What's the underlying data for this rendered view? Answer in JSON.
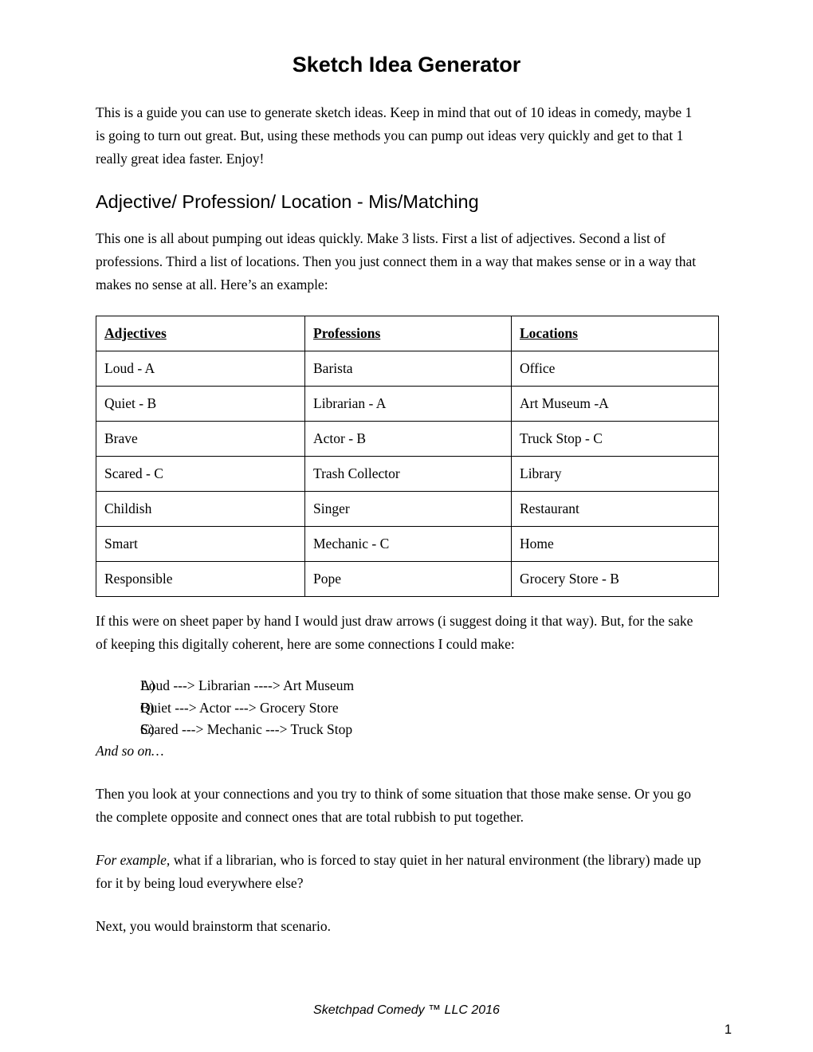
{
  "document": {
    "title": "Sketch Idea Generator",
    "intro_paragraph": "This is a guide you can use to generate sketch ideas. Keep in mind that out of 10 ideas in comedy, maybe 1 is going to turn out great. But, using these methods you can pump out ideas very quickly and get to that 1 really great idea faster. Enjoy!",
    "section_heading": "Adjective/ Profession/ Location - Mis/Matching",
    "section_paragraph": "This one is all about pumping out ideas quickly. Make 3 lists. First a list of adjectives. Second a list of professions. Third a list of locations. Then you just connect them in a way that makes sense or in a way that makes no sense at all. Here’s an example:",
    "post_table_paragraph": "If this were on sheet paper by hand I would just draw arrows (i suggest doing it that way). But, for the sake of keeping this digitally coherent, here are some connections I could make:",
    "and_so_on": "And so on…",
    "then_paragraph": "Then you look at your connections and you try to think of some situation that those make sense. Or you go the complete opposite and connect ones that are total rubbish to put together.",
    "example_label": "For example,",
    "example_paragraph": " what if a librarian, who is forced to stay quiet in her natural environment (the library) made up for it by being loud everywhere else?",
    "next_paragraph": "Next, you would brainstorm that scenario."
  },
  "table": {
    "headers": [
      "Adjectives",
      "Professions",
      "Locations"
    ],
    "rows": [
      [
        "Loud - A",
        "Barista",
        "Office"
      ],
      [
        "Quiet - B",
        "Librarian - A",
        "Art Museum -A"
      ],
      [
        "Brave",
        "Actor - B",
        "Truck Stop - C"
      ],
      [
        "Scared - C",
        "Trash Collector",
        "Library"
      ],
      [
        "Childish",
        "Singer",
        "Restaurant"
      ],
      [
        "Smart",
        "Mechanic - C",
        "Home"
      ],
      [
        "Responsible",
        "Pope",
        "Grocery Store - B"
      ]
    ]
  },
  "connections": [
    {
      "marker": "A)",
      "text": "Loud ---> Librarian ----> Art Museum"
    },
    {
      "marker": "B)",
      "text": "Quiet ---> Actor ---> Grocery Store"
    },
    {
      "marker": "C)",
      "text": "Scared ---> Mechanic ---> Truck Stop"
    }
  ],
  "footer": {
    "note": "Sketchpad Comedy ™ LLC 2016",
    "page_number": "1"
  },
  "colors": {
    "text": "#000000",
    "background": "#ffffff",
    "table_border": "#000000"
  }
}
